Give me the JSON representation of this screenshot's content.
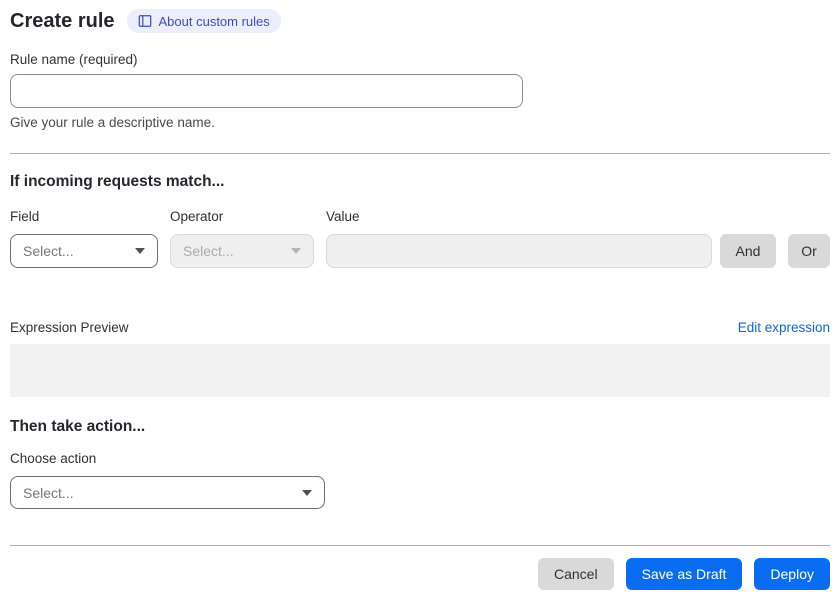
{
  "page": {
    "title": "Create rule",
    "about_link": "About custom rules"
  },
  "rule_name": {
    "label": "Rule name (required)",
    "value": "",
    "helper": "Give your rule a descriptive name."
  },
  "match_section": {
    "heading": "If incoming requests match...",
    "field": {
      "label": "Field",
      "selected": "Select..."
    },
    "operator": {
      "label": "Operator",
      "selected": "Select...",
      "disabled": true
    },
    "value": {
      "label": "Value",
      "value": "",
      "disabled": true
    },
    "and_button": "And",
    "or_button": "Or",
    "expression_preview_label": "Expression Preview",
    "edit_expression_link": "Edit expression",
    "expression_value": ""
  },
  "action_section": {
    "heading": "Then take action...",
    "choose_action_label": "Choose action",
    "selected": "Select..."
  },
  "footer": {
    "cancel": "Cancel",
    "save_draft": "Save as Draft",
    "deploy": "Deploy"
  },
  "colors": {
    "accent_blue": "#0a6cf1",
    "link_blue": "#0d66d8",
    "badge_bg": "#eceefb",
    "badge_text": "#3d4bc7"
  },
  "icons": {
    "about_badge": "book-icon",
    "selects": "chevron-down-icon"
  }
}
